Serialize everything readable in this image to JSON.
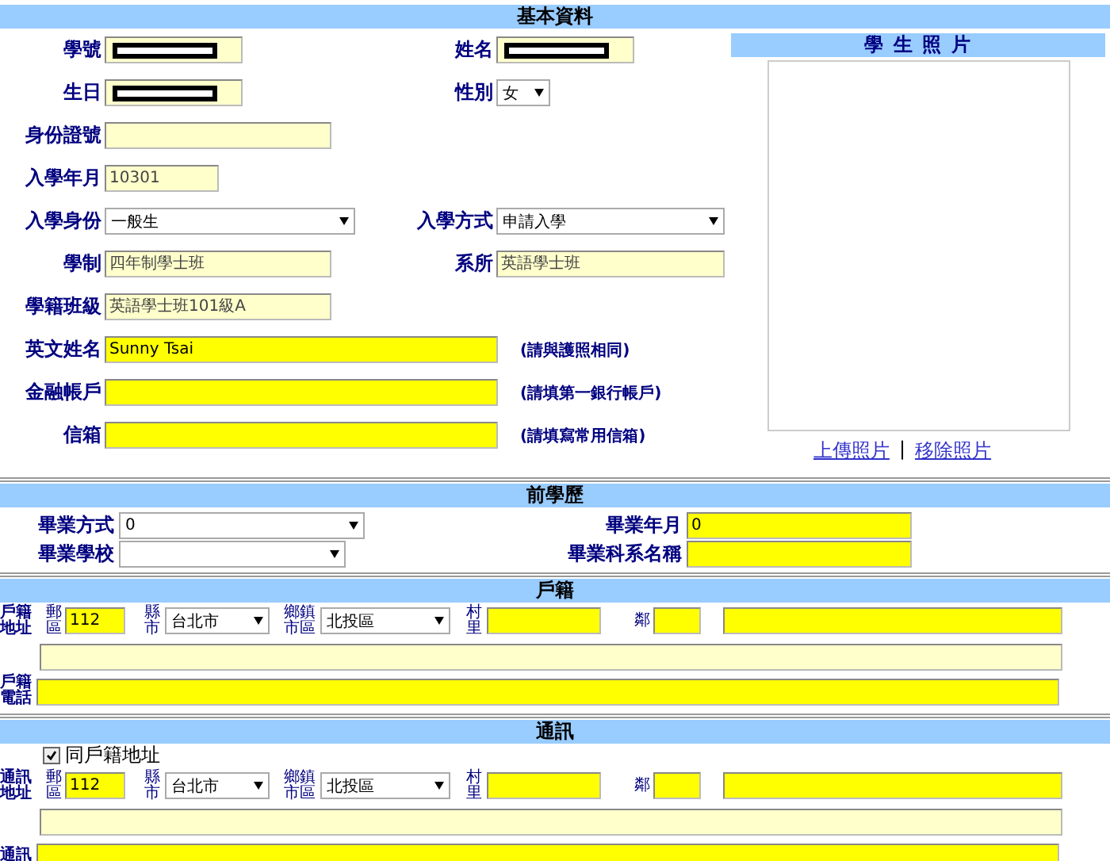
{
  "basic_info": {
    "title": "基本資料",
    "rows": [
      {
        "items": [
          {
            "label": "學號",
            "kind": "text",
            "redacted": true,
            "highlighted": false
          },
          {
            "label": "姓名",
            "kind": "text",
            "redacted": true,
            "highlighted": false
          }
        ]
      },
      {
        "items": [
          {
            "label": "生日",
            "kind": "text",
            "redacted": true,
            "highlighted": false
          },
          {
            "label": "性別",
            "kind": "select",
            "value": "女"
          }
        ]
      },
      {
        "items": [
          {
            "label": "身份證號",
            "kind": "text",
            "redacted": false,
            "highlighted": false
          }
        ]
      },
      {
        "items": [
          {
            "label": "入學年月",
            "kind": "readonly",
            "value": "10301"
          }
        ]
      },
      {
        "items": [
          {
            "label": "入學身份",
            "kind": "select",
            "value": "一般生"
          },
          {
            "label": "入學方式",
            "kind": "select",
            "value": "申請入學"
          }
        ]
      },
      {
        "items": [
          {
            "label": "學制",
            "kind": "readonly",
            "value": "四年制學士班"
          },
          {
            "label": "系所",
            "kind": "readonly",
            "value": "英語學士班"
          }
        ]
      },
      {
        "items": [
          {
            "label": "學籍班級",
            "kind": "readonly",
            "value": "英語學士班101級A"
          }
        ]
      },
      {
        "items": [
          {
            "label": "英文姓名",
            "kind": "text",
            "redacted": false,
            "highlighted": true,
            "value": "Sunny Tsai",
            "note": "(請與護照相同)"
          }
        ]
      },
      {
        "items": [
          {
            "label": "金融帳戶",
            "kind": "text",
            "redacted": false,
            "highlighted": true,
            "note": "(請填第一銀行帳戶)"
          }
        ]
      },
      {
        "items": [
          {
            "label": "信箱",
            "kind": "text",
            "redacted": false,
            "highlighted": true,
            "note": "(請填寫常用信箱)"
          }
        ]
      }
    ]
  },
  "photo": {
    "title": "學 生 照 片",
    "links": [
      "上傳照片",
      "移除照片"
    ],
    "separator": "|"
  },
  "prior_education": {
    "title": "前學歷",
    "rows": [
      {
        "items": [
          {
            "label": "畢業方式",
            "kind": "select",
            "value": "0"
          },
          {
            "label": "畢業年月",
            "kind": "text",
            "highlighted": true,
            "value": "0"
          }
        ]
      },
      {
        "items": [
          {
            "label": "畢業學校",
            "kind": "select"
          },
          {
            "label": "畢業科系名稱",
            "kind": "text",
            "highlighted": true
          }
        ]
      }
    ]
  },
  "household": {
    "title": "戶籍",
    "address_label": "戶籍地址",
    "zip_label": "郵區",
    "zip": "112",
    "city_label": "縣市",
    "city": "台北市",
    "district_label": "鄉鎮市區",
    "district": "北投區",
    "village_label": "村里",
    "neighbor_label": "鄰",
    "phone_label": "戶籍電話"
  },
  "contact": {
    "title": "通訊",
    "same_as_household": {
      "label": "同戶籍地址",
      "checked": true
    },
    "address_label": "通訊地址",
    "zip_label": "郵區",
    "zip": "112",
    "city_label": "縣市",
    "city": "台北市",
    "district_label": "鄉鎮市區",
    "district": "北投區",
    "village_label": "村里",
    "neighbor_label": "鄰",
    "phone_label": "通訊"
  }
}
